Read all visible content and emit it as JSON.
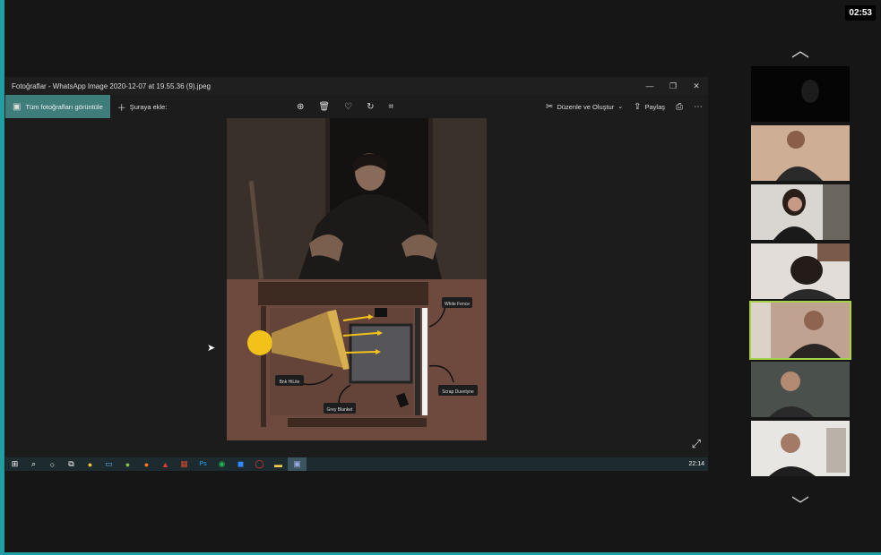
{
  "meeting": {
    "elapsed_time": "02:53"
  },
  "photos_app": {
    "window_title": "Fotoğraflar - WhatsApp Image 2020-12-07 at 19.55.36 (9).jpeg",
    "toolbar": {
      "all_photos_label": "Tüm fotoğrafları görüntüle",
      "add_to_label": "Şuraya ekle:",
      "edit_create_label": "Düzenle ve Oluştur",
      "share_label": "Paylaş"
    },
    "diagram_labels": {
      "white_fence": "White Fence",
      "bnk_hilite": "Bnk HiLite",
      "grey_blanket": "Grey Blanket",
      "scrap_duvetyne": "Scrap Duvetyne"
    }
  },
  "taskbar": {
    "time": "22:14"
  },
  "icons": {
    "colors": {
      "accent": "#1e9fa4",
      "active_speaker": "#a8d24a",
      "photos_selected": "#3e7d7a"
    }
  }
}
